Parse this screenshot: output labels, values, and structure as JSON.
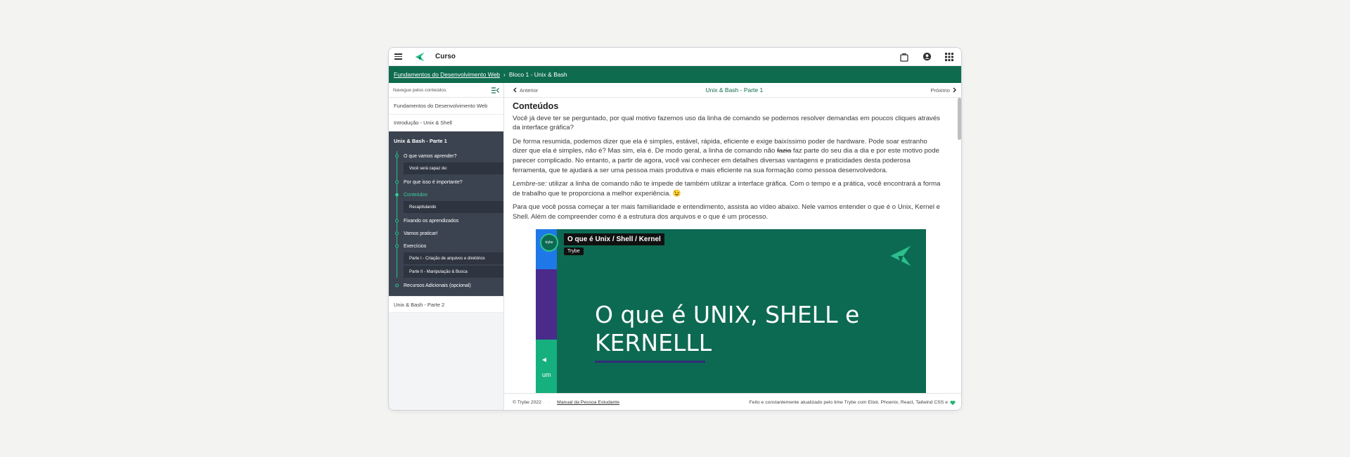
{
  "header": {
    "app_title": "Curso",
    "icons": [
      "menu-icon",
      "trybe-logo",
      "backpack-icon",
      "user-icon",
      "grid-icon"
    ]
  },
  "breadcrumb": {
    "link": "Fundamentos do Desenvolvimento Web",
    "separator": "›",
    "current": "Bloco 1 - Unix & Bash"
  },
  "sidebar": {
    "header_label": "Navegue pelos conteúdos:",
    "items_top": [
      "Fundamentos do Desenvolvimento Web",
      "Introdução - Unix & Shell"
    ],
    "section": {
      "title": "Unix & Bash - Parte 1",
      "timeline": [
        {
          "label": "O que vamos aprender?",
          "sub": [
            "Você será capaz de:"
          ]
        },
        {
          "label": "Por que isso é importante?",
          "sub": []
        },
        {
          "label": "Conteúdos",
          "active": true,
          "sub": [
            "Recapitulando"
          ]
        },
        {
          "label": "Fixando os aprendizados",
          "sub": []
        },
        {
          "label": "Vamos praticar!",
          "sub": []
        },
        {
          "label": "Exercícios",
          "sub": [
            "Parte I - Criação de arquivos e diretórios",
            "Parte II - Manipulação & Busca"
          ]
        },
        {
          "label": "Recursos Adicionais (opcional)",
          "sub": []
        }
      ]
    },
    "items_bottom": [
      "Unix & Bash - Parte 2"
    ]
  },
  "nav": {
    "prev": "Anterior",
    "title": "Unix & Bash - Parte 1",
    "next": "Próximo"
  },
  "article": {
    "heading": "Conteúdos",
    "p1": "Você já deve ter se perguntado, por qual motivo fazemos uso da linha de comando se podemos resolver demandas em poucos cliques através da interface gráfica?",
    "p2a": "De forma resumida, podemos dizer que ela é simples, estável, rápida, eficiente e exige baixíssimo poder de hardware. Pode soar estranho dizer que ela é simples, não é? Mas sim, ela é. De modo geral, a linha de comando não ",
    "p2_strike": "fazia",
    "p2b": " faz parte do seu dia a dia e por este motivo pode parecer complicado. No entanto, a partir de agora, você vai conhecer em detalhes diversas vantagens e praticidades desta poderosa ferramenta, que te ajudará a ser uma pessoa mais produtiva e mais eficiente na sua formação como pessoa desenvolvedora.",
    "p3_em": "Lembre-se:",
    "p3": " utilizar a linha de comando não te impede de também utilizar a interface gráfica. Com o tempo e a prática, você encontrará a forma de trabalho que te proporciona a melhor experiência. 😉",
    "p4": "Para que você possa começar a ter mais familiaridade e entendimento, assista ao vídeo abaixo. Nele vamos entender o que é o Unix, Kernel e Shell. Além de compreender como é a estrutura dos arquivos e o que é um processo."
  },
  "video": {
    "title": "O que é Unix / Shell / Kernel",
    "channel": "Trybe",
    "channel_badge": "trybe",
    "big_line1": "O que é UNIX, SHELL e",
    "big_line2": "KERNELLL",
    "stripe_text": "um"
  },
  "footer": {
    "copyright": "© Trybe 2022",
    "separator": "·",
    "manual_link": "Manual da Pessoa Estudante",
    "credit": "Feito e constantemente atualizado pelo time Trybe com Elixir, Phoenix, React, Tailwind CSS e"
  },
  "colors": {
    "brand_green": "#0e6b4e",
    "accent_green": "#28c08f",
    "sidebar_dark": "#3b4350"
  }
}
